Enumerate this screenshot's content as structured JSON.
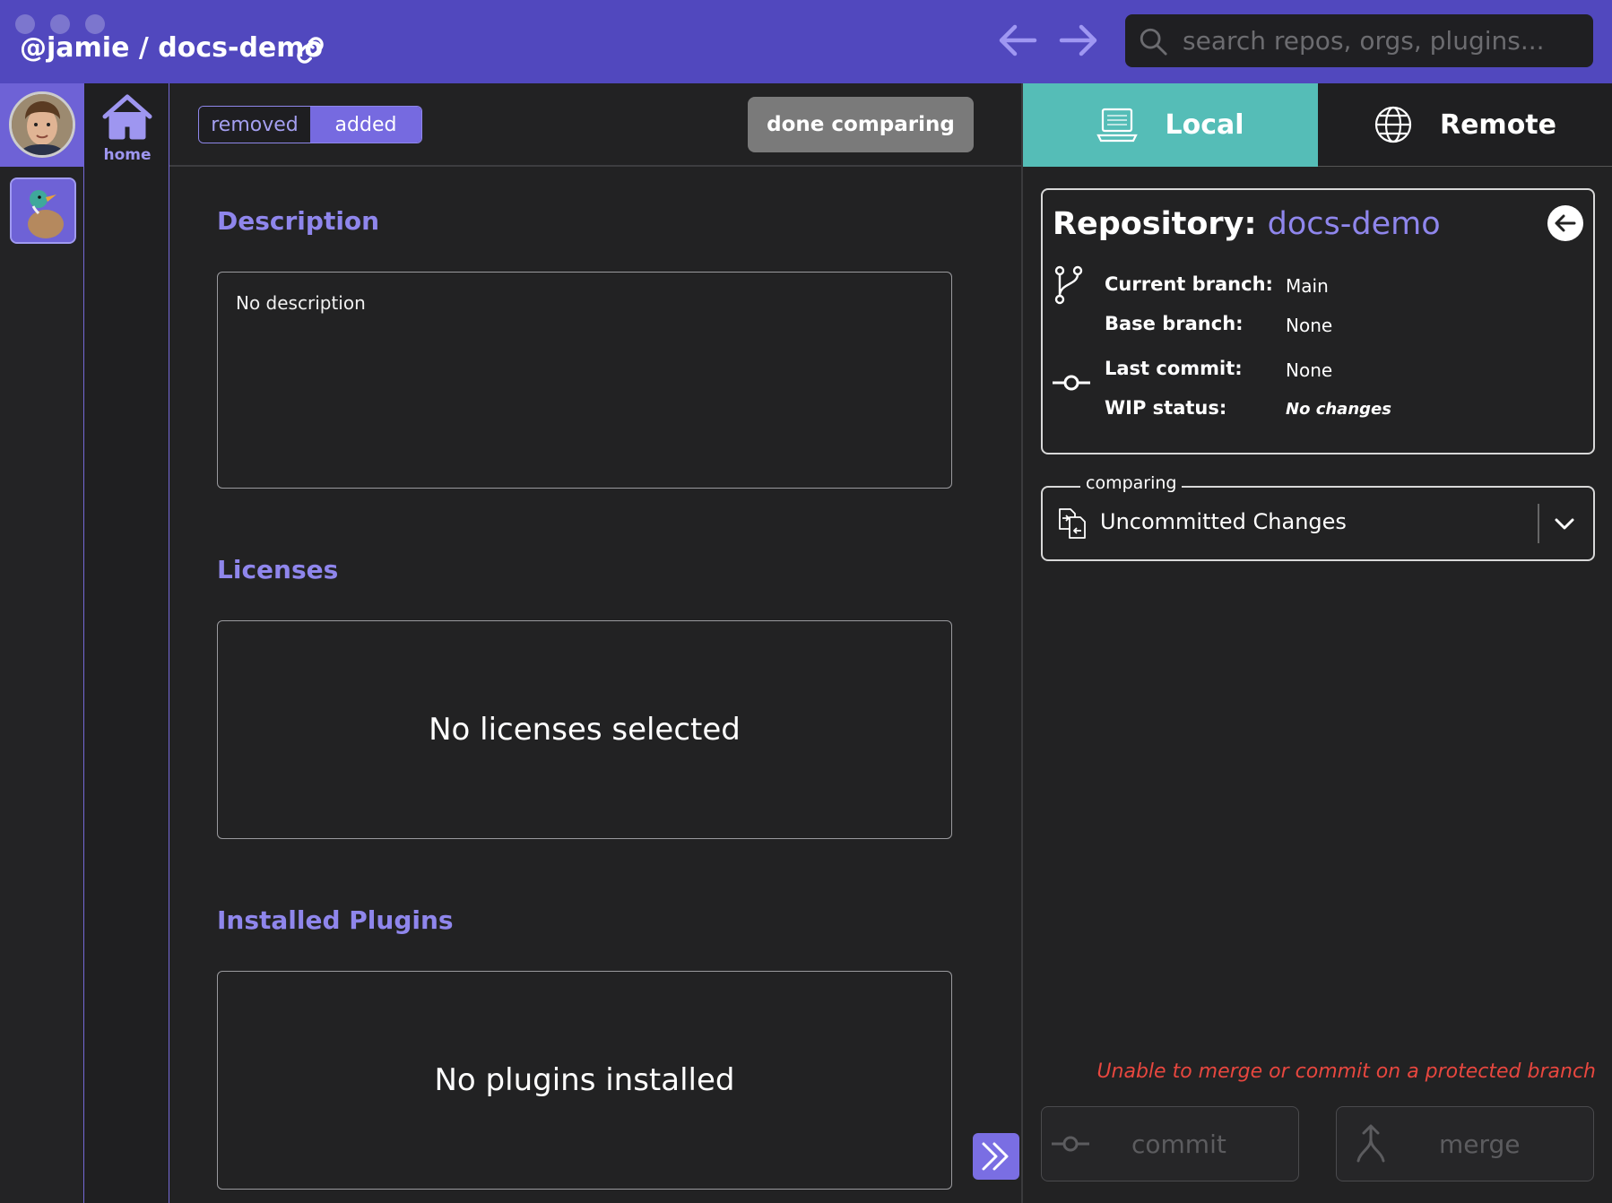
{
  "window": {
    "title": "@jamie / docs-demo"
  },
  "search": {
    "placeholder": "search repos, orgs, plugins..."
  },
  "sidebar": {
    "home_label": "home"
  },
  "toolbar": {
    "toggle_removed": "removed",
    "toggle_added": "added",
    "toggle_selected": "added",
    "done_label": "done comparing"
  },
  "sections": {
    "description": {
      "title": "Description",
      "text": "No description"
    },
    "licenses": {
      "title": "Licenses",
      "empty_text": "No licenses selected"
    },
    "plugins": {
      "title": "Installed Plugins",
      "empty_text": "No plugins installed"
    }
  },
  "tabs": {
    "local": "Local",
    "remote": "Remote",
    "active": "Local"
  },
  "repo_card": {
    "label": "Repository:",
    "name": "docs-demo",
    "rows": [
      {
        "label": "Current branch:",
        "value": "Main"
      },
      {
        "label": "Base branch:",
        "value": "None"
      },
      {
        "label": "Last commit:",
        "value": "None"
      },
      {
        "label": "WIP status:",
        "value": "No changes"
      }
    ]
  },
  "comparing": {
    "legend": "comparing",
    "value": "Uncommitted Changes"
  },
  "warning": "Unable to merge or commit on a protected branch",
  "actions": {
    "commit_label": "commit",
    "merge_label": "merge"
  },
  "colors": {
    "titlebar": "#5148be",
    "accent": "#8f86ec",
    "toggle_active": "#766ae0",
    "local_tab": "#55bdb7",
    "warning": "#e8473f",
    "done_button": "#7a7a7a"
  }
}
